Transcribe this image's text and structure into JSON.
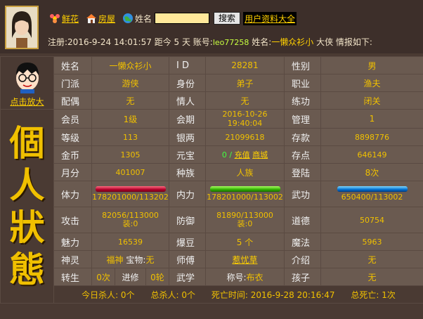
{
  "header": {
    "links": {
      "flower": "鲜花",
      "house": "房屋"
    },
    "name_label": "姓名",
    "search_button": "搜索",
    "all_info_link": "用户资料大全",
    "info_line": {
      "register": "注册:2016-9-24 14:01:57",
      "distance": "距今 5 天",
      "account_label": "账号:",
      "account": "leo77258",
      "name_prefix": "姓名:",
      "name": "一懒众衫小",
      "suffix": "大侠 情报如下:"
    }
  },
  "side": {
    "click_enlarge": "点击放大",
    "title_chars": [
      "個",
      "人",
      "狀",
      "態"
    ]
  },
  "rows": {
    "r1": {
      "l1": "姓名",
      "v1": "一懒众衫小",
      "l2": "I D",
      "v2": "28281",
      "l3": "性别",
      "v3": "男"
    },
    "r2": {
      "l1": "门派",
      "v1": "游侠",
      "l2": "身份",
      "v2": "弟子",
      "l3": "职业",
      "v3": "渔夫"
    },
    "r3": {
      "l1": "配偶",
      "v1": "无",
      "l2": "情人",
      "v2": "无",
      "l3": "练功",
      "v3": "闭关"
    },
    "r4": {
      "l1": "会员",
      "v1": "1级",
      "l2": "会期",
      "v2": "2016-10-26 19:40:04",
      "l3": "管理",
      "v3": "1"
    },
    "r5": {
      "l1": "等级",
      "v1": "113",
      "l2": "银两",
      "v2": "21099618",
      "l3": "存款",
      "v3": "8898776"
    },
    "r6": {
      "l1": "金币",
      "v1": "1305",
      "l2": "元宝",
      "v2_num": "0",
      "v2_sep": "/",
      "v2_recharge": "充值",
      "v2_shop": "商城",
      "l3": "存点",
      "v3": "646149"
    },
    "r7": {
      "l1": "月分",
      "v1": "401007",
      "l2": "种族",
      "v2": "人族",
      "l3": "登陆",
      "v3": "8次"
    },
    "r8": {
      "l1": "体力",
      "v1": "178201000/113202",
      "l2": "内力",
      "v2": "178201000/113002",
      "l3": "武功",
      "v3": "650400/113002"
    },
    "r9": {
      "l1": "攻击",
      "v1a": "82056/113000",
      "v1b": "装:0",
      "l2": "防御",
      "v2a": "81890/113000",
      "v2b": "装:0",
      "l3": "道德",
      "v3": "50754"
    },
    "r10": {
      "l1": "魅力",
      "v1": "16539",
      "l2": "爆豆",
      "v2": "5 个",
      "l3": "魔法",
      "v3": "5963"
    },
    "r11": {
      "l1": "神灵",
      "v1a": "福神",
      "v1b_label": "宝物:",
      "v1b": "无",
      "l2": "师傅",
      "v2": "惹忧草",
      "l3": "介绍",
      "v3": "无"
    },
    "r12": {
      "l1": "转生",
      "v1a": "0次",
      "v1b_label": "进修",
      "v1c": "0轮",
      "l2": "武学",
      "v2_label": "称号:",
      "v2": "布衣",
      "l3": "孩子",
      "v3": "无"
    }
  },
  "footer": {
    "today_kills": "今日杀人: 0个",
    "total_kills": "总杀人: 0个",
    "death_time": "死亡时间: 2016-9-28 20:16:47",
    "total_deaths": "总死亡: 1次"
  },
  "bars": {
    "hp_fill": 1.0,
    "mp_fill": 1.0,
    "skill_fill": 1.0
  }
}
